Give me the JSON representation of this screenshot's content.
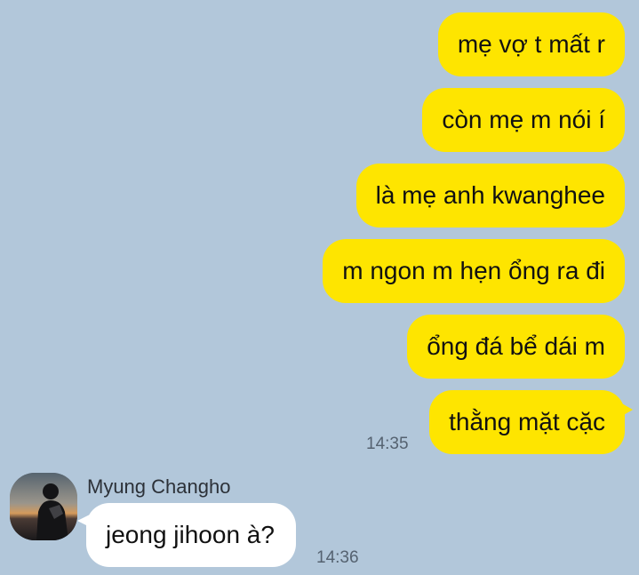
{
  "chat": {
    "outgoing_messages": [
      {
        "text": "mẹ vợ t mất r"
      },
      {
        "text": "còn mẹ m nói í"
      },
      {
        "text": "là mẹ anh kwanghee"
      },
      {
        "text": "m ngon m hẹn ổng ra đi"
      },
      {
        "text": "ổng đá bể dái m"
      },
      {
        "text": "thằng mặt cặc"
      }
    ],
    "outgoing_time": "14:35",
    "incoming": {
      "sender_name": "Myung Changho",
      "text": "jeong jihoon à?",
      "time": "14:36"
    }
  },
  "colors": {
    "background": "#b2c7da",
    "outgoing_bubble": "#fee500",
    "incoming_bubble": "#ffffff"
  }
}
